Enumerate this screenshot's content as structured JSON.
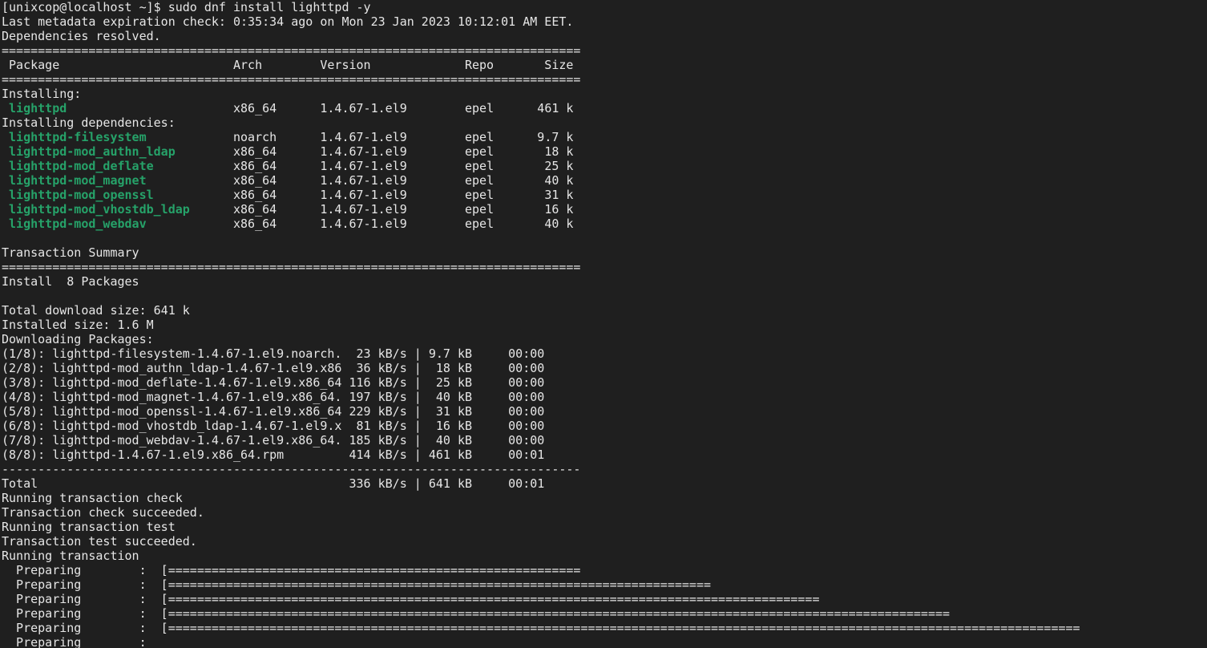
{
  "terminal": {
    "colors": {
      "background": "#1f1f1f",
      "text": "#e6e6e6",
      "package_name": "#26a269"
    },
    "lines": [
      "[unixcop@localhost ~]$ sudo dnf install lighttpd -y",
      "Last metadata expiration check: 0:35:34 ago on Mon 23 Jan 2023 10:12:01 AM EET.",
      "Dependencies resolved.",
      "================================================================================",
      " Package                        Arch        Version             Repo       Size",
      "================================================================================",
      "Installing:",
      "Installing dependencies:",
      "",
      "Transaction Summary",
      "================================================================================",
      "Install  8 Packages",
      "",
      "Total download size: 641 k",
      "Installed size: 1.6 M",
      "Downloading Packages:",
      "(1/8): lighttpd-filesystem-1.4.67-1.el9.noarch.  23 kB/s | 9.7 kB     00:00",
      "(2/8): lighttpd-mod_authn_ldap-1.4.67-1.el9.x86  36 kB/s |  18 kB     00:00",
      "(3/8): lighttpd-mod_deflate-1.4.67-1.el9.x86_64 116 kB/s |  25 kB     00:00",
      "(4/8): lighttpd-mod_magnet-1.4.67-1.el9.x86_64. 197 kB/s |  40 kB     00:00",
      "(5/8): lighttpd-mod_openssl-1.4.67-1.el9.x86_64 229 kB/s |  31 kB     00:00",
      "(6/8): lighttpd-mod_vhostdb_ldap-1.4.67-1.el9.x  81 kB/s |  16 kB     00:00",
      "(7/8): lighttpd-mod_webdav-1.4.67-1.el9.x86_64. 185 kB/s |  40 kB     00:00",
      "(8/8): lighttpd-1.4.67-1.el9.x86_64.rpm         414 kB/s | 461 kB     00:01",
      "--------------------------------------------------------------------------------",
      "Total                                           336 kB/s | 641 kB     00:01",
      "Running transaction check",
      "Transaction check succeeded.",
      "Running transaction test",
      "Transaction test succeeded.",
      "Running transaction",
      "  Preparing        :  [=========================================================",
      "  Preparing        :  [===========================================================================",
      "  Preparing        :  [==========================================================================================",
      "  Preparing        :  [============================================================================================================",
      "  Preparing        :  [==============================================================================================================================",
      "  Preparing        :"
    ],
    "packages": [
      {
        "name": "lighttpd",
        "rest": "x86_64      1.4.67-1.el9        epel      461 k"
      },
      {
        "name": "lighttpd-filesystem",
        "rest": "noarch      1.4.67-1.el9        epel      9.7 k"
      },
      {
        "name": "lighttpd-mod_authn_ldap",
        "rest": "x86_64      1.4.67-1.el9        epel       18 k"
      },
      {
        "name": "lighttpd-mod_deflate",
        "rest": "x86_64      1.4.67-1.el9        epel       25 k"
      },
      {
        "name": "lighttpd-mod_magnet",
        "rest": "x86_64      1.4.67-1.el9        epel       40 k"
      },
      {
        "name": "lighttpd-mod_openssl",
        "rest": "x86_64      1.4.67-1.el9        epel       31 k"
      },
      {
        "name": "lighttpd-mod_vhostdb_ldap",
        "rest": "x86_64      1.4.67-1.el9        epel       16 k"
      },
      {
        "name": "lighttpd-mod_webdav",
        "rest": "x86_64      1.4.67-1.el9        epel       40 k"
      }
    ]
  }
}
